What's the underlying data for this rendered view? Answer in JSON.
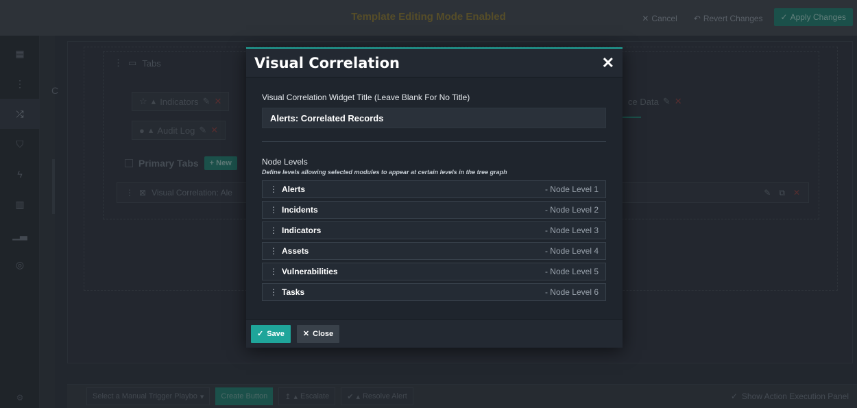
{
  "topbar": {
    "mode_title": "Template Editing Mode Enabled",
    "cancel_label": "Cancel",
    "revert_label": "Revert Changes",
    "apply_label": "Apply Changes"
  },
  "sidebar": {
    "icons": [
      "grid-icon",
      "hierarchy-icon",
      "shuffle-icon",
      "shield-icon",
      "bolt-icon",
      "building-icon",
      "chart-icon",
      "globe-icon"
    ],
    "active_index": 2
  },
  "background": {
    "c_letter": "C",
    "tabs_label": "Tabs",
    "indicators_label": "Indicators",
    "audit_log_label": "Audit Log",
    "source_data_label": "ce Data",
    "primary_tabs_label": "Primary Tabs",
    "new_label": "+ New",
    "visual_correlation_label": "Visual Correlation: Ale"
  },
  "footer": {
    "playbook_select": "Select a Manual Trigger Playbo",
    "create_button": "Create Button",
    "escalate": "Escalate",
    "resolve_alert": "Resolve Alert",
    "show_panel": "Show Action Execution Panel"
  },
  "modal": {
    "title": "Visual Correlation",
    "widget_title_label": "Visual Correlation Widget Title (Leave Blank For No Title)",
    "widget_title_value": "Alerts: Correlated Records",
    "node_levels_title": "Node Levels",
    "node_levels_subtitle": "Define levels allowing selected modules to appear at certain levels in the tree graph",
    "levels": [
      {
        "name": "Alerts",
        "level": "- Node Level 1"
      },
      {
        "name": "Incidents",
        "level": "- Node Level 2"
      },
      {
        "name": "Indicators",
        "level": "- Node Level 3"
      },
      {
        "name": "Assets",
        "level": "- Node Level 4"
      },
      {
        "name": "Vulnerabilities",
        "level": "- Node Level 5"
      },
      {
        "name": "Tasks",
        "level": "- Node Level 6"
      }
    ],
    "save_label": "Save",
    "close_label": "Close"
  },
  "colors": {
    "accent": "#1fa59a",
    "modal_bg": "#1f252d"
  }
}
